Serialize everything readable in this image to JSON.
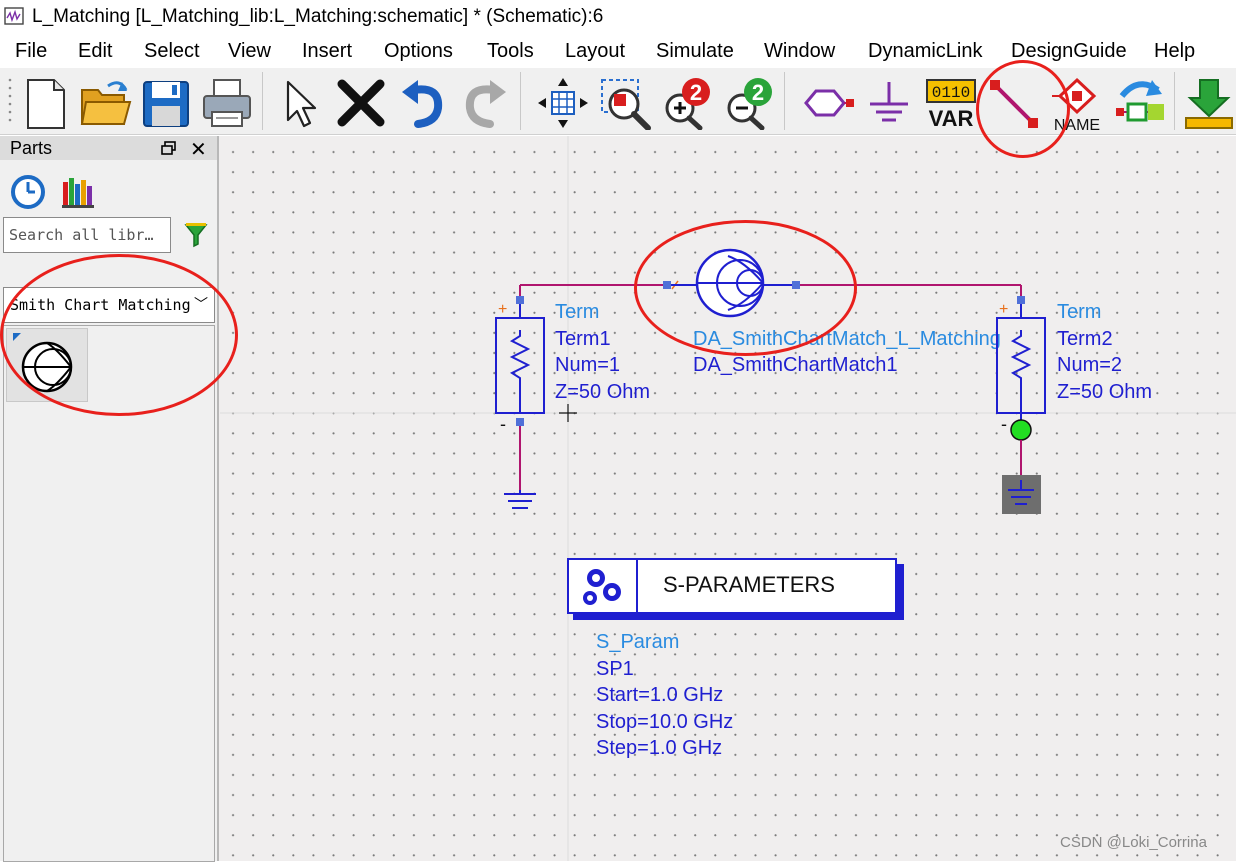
{
  "window": {
    "title": "L_Matching [L_Matching_lib:L_Matching:schematic] * (Schematic):6"
  },
  "menu": [
    "File",
    "Edit",
    "Select",
    "View",
    "Insert",
    "Options",
    "Tools",
    "Layout",
    "Simulate",
    "Window",
    "DynamicLink",
    "DesignGuide",
    "Help"
  ],
  "toolbar": {
    "var_icon_digits": "0110",
    "var_icon_label": "VAR",
    "name_icon_label": "NAME",
    "zoom_in_digit": "2",
    "zoom_out_digit": "2"
  },
  "parts": {
    "title": "Parts",
    "search_placeholder": "Search all libr…",
    "library_selected": "Smith Chart Matching"
  },
  "schematic": {
    "term1": {
      "type": "Term",
      "name": "Term1",
      "num": "Num=1",
      "z": "Z=50 Ohm"
    },
    "term2": {
      "type": "Term",
      "name": "Term2",
      "num": "Num=2",
      "z": "Z=50 Ohm"
    },
    "smith": {
      "type": "DA_SmithChartMatch_L_Matching",
      "name": "DA_SmithChartMatch1"
    },
    "sparam": {
      "block_label": "S-PARAMETERS",
      "type": "S_Param",
      "name": "SP1",
      "start": "Start=1.0 GHz",
      "stop": "Stop=10.0 GHz",
      "step": "Step=1.0 GHz"
    },
    "plus_sign": "+",
    "minus_sign": "-"
  },
  "colors": {
    "wire": "#b0156e",
    "component": "#1f1fd0",
    "type_label": "#2a8be0",
    "pin": "#5070d8",
    "annotation": "#e8201c",
    "canvas_bg": "#f0eeee"
  },
  "watermark": "CSDN @Loki_Corrina"
}
